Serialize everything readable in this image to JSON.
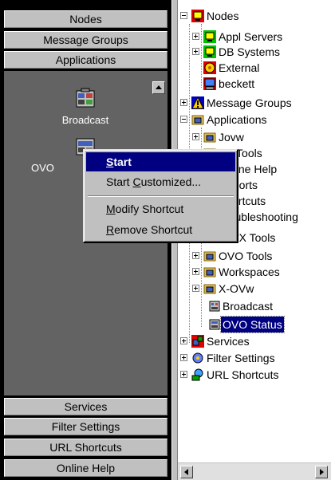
{
  "left_bar": {
    "top_buttons": [
      "Nodes",
      "Message Groups",
      "Applications"
    ],
    "tiles": [
      {
        "label": "Broadcast",
        "icon": "broadcast-app-icon"
      },
      {
        "label": "OVO",
        "icon": "ovo-status-app-icon"
      }
    ],
    "bottom_buttons": [
      "Services",
      "Filter Settings",
      "URL Shortcuts",
      "Online Help"
    ]
  },
  "context_menu": {
    "items": [
      {
        "label": "Start",
        "pre": "",
        "mnemonic": "S",
        "post": "tart",
        "active": true
      },
      {
        "label": "Start Customized...",
        "pre": "Start ",
        "mnemonic": "C",
        "post": "ustomized..."
      },
      {
        "label": "Modify Shortcut",
        "pre": "",
        "mnemonic": "M",
        "post": "odify Shortcut"
      },
      {
        "label": "Remove Shortcut",
        "pre": "",
        "mnemonic": "R",
        "post": "emove Shortcut"
      }
    ]
  },
  "tree": {
    "nodes": [
      {
        "label": "Nodes",
        "icon": "nodes-icon",
        "expander": "minus"
      },
      {
        "label": "Appl Servers",
        "icon": "node-group-icon",
        "expander": "plus"
      },
      {
        "label": "DB Systems",
        "icon": "node-group-icon",
        "expander": "plus"
      },
      {
        "label": "External",
        "icon": "external-node-icon",
        "expander": ""
      },
      {
        "label": "beckett",
        "icon": "workstation-icon",
        "expander": ""
      },
      {
        "label": "Message Groups",
        "icon": "warning-icon",
        "expander": "plus"
      },
      {
        "label": "Applications",
        "icon": "applications-icon",
        "expander": "minus"
      },
      {
        "label": "Jovw",
        "icon": "app-group-icon",
        "expander": "plus"
      },
      {
        "label": "NT Tools",
        "icon": "app-group-icon",
        "expander": "plus"
      },
      {
        "label": "Online Help",
        "icon": "app-group-icon",
        "expander": "plus"
      },
      {
        "label": "Reports",
        "icon": "app-group-icon",
        "expander": "plus"
      },
      {
        "label": "Shortcuts",
        "icon": "app-group-icon",
        "expander": "plus"
      },
      {
        "label": "Troubleshooting",
        "icon": "app-group-icon",
        "expander": "plus"
      },
      {
        "label": "UN*X Tools",
        "icon": "app-group-icon",
        "expander": "plus"
      },
      {
        "label": "OVO Tools",
        "icon": "app-group-icon",
        "expander": "plus"
      },
      {
        "label": "Workspaces",
        "icon": "app-group-icon",
        "expander": "plus"
      },
      {
        "label": "X-OVw",
        "icon": "app-group-icon",
        "expander": "plus"
      },
      {
        "label": "Broadcast",
        "icon": "app-icon",
        "expander": ""
      },
      {
        "label": "OVO Status",
        "icon": "app-icon",
        "expander": "",
        "selected": true
      },
      {
        "label": "Services",
        "icon": "services-icon",
        "expander": "plus"
      },
      {
        "label": "Filter Settings",
        "icon": "filter-icon",
        "expander": "plus"
      },
      {
        "label": "URL Shortcuts",
        "icon": "url-shortcut-icon",
        "expander": "plus"
      }
    ]
  },
  "colors": {
    "selection": "#000080",
    "panel_bg": "#636363",
    "button_face": "#c0c0c0"
  }
}
